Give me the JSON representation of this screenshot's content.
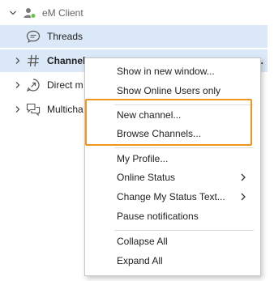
{
  "sidebar": {
    "account": {
      "label": "eM Client",
      "icon": "users-icon"
    },
    "items": [
      {
        "label": "Threads",
        "icon": "chat-bubble-icon",
        "selected": true
      },
      {
        "label": "Channels",
        "icon": "hash-icon",
        "selected": true,
        "bold": true,
        "more": "..."
      },
      {
        "label": "Direct m",
        "icon": "direct-message-icon"
      },
      {
        "label": "Multicha",
        "icon": "multichat-icon"
      }
    ]
  },
  "context_menu": {
    "groups": [
      [
        {
          "label": "Show in new window..."
        },
        {
          "label": "Show Online Users only"
        }
      ],
      [
        {
          "label": "New channel..."
        },
        {
          "label": "Browse Channels..."
        }
      ],
      [
        {
          "label": "My Profile..."
        },
        {
          "label": "Online Status",
          "submenu": true
        },
        {
          "label": "Change My Status Text...",
          "submenu": true
        },
        {
          "label": "Pause notifications"
        }
      ],
      [
        {
          "label": "Collapse All"
        },
        {
          "label": "Expand All"
        }
      ]
    ]
  },
  "colors": {
    "selection": "#dbe8f8",
    "highlight_border": "#f0961e",
    "online_dot": "#6cc04a"
  }
}
